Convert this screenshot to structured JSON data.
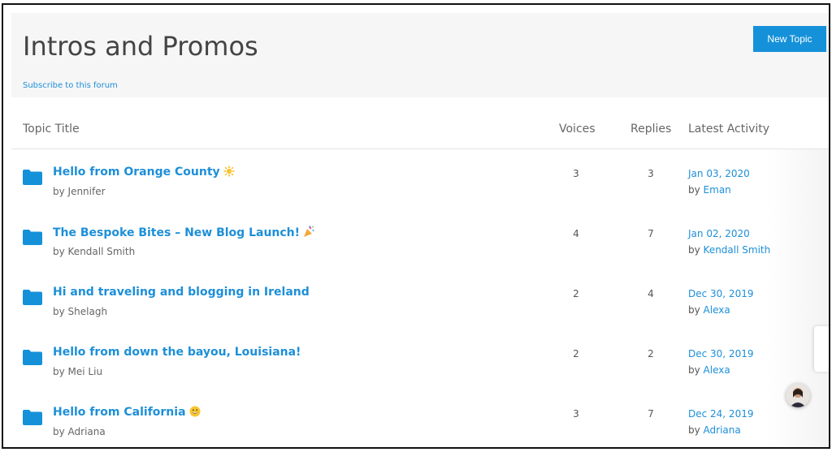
{
  "forum": {
    "title": "Intros and Promos",
    "subscribe_label": "Subscribe to this forum",
    "new_topic_label": "New Topic"
  },
  "columns": {
    "topic": "Topic Title",
    "voices": "Voices",
    "replies": "Replies",
    "activity": "Latest Activity"
  },
  "by_label": "by",
  "topics": [
    {
      "title": "Hello from Orange County",
      "emoji": "sun",
      "author": "Jennifer",
      "voices": "3",
      "replies": "3",
      "date": "Jan 03, 2020",
      "last_user": "Eman"
    },
    {
      "title": "The Bespoke Bites – New Blog Launch!",
      "emoji": "party-popper",
      "author": "Kendall Smith",
      "voices": "4",
      "replies": "7",
      "date": "Jan 02, 2020",
      "last_user": "Kendall Smith"
    },
    {
      "title": "Hi and traveling and blogging in Ireland",
      "emoji": "",
      "author": "Shelagh",
      "voices": "2",
      "replies": "4",
      "date": "Dec 30, 2019",
      "last_user": "Alexa"
    },
    {
      "title": "Hello from down the bayou, Louisiana!",
      "emoji": "",
      "author": "Mei Liu",
      "voices": "2",
      "replies": "2",
      "date": "Dec 30, 2019",
      "last_user": "Alexa"
    },
    {
      "title": "Hello from California",
      "emoji": "grinning-face",
      "author": "Adriana",
      "voices": "3",
      "replies": "7",
      "date": "Dec 24, 2019",
      "last_user": "Adriana"
    }
  ],
  "colors": {
    "link": "#1d8fd8",
    "button": "#1591d9",
    "header_bg": "#f6f6f6"
  }
}
